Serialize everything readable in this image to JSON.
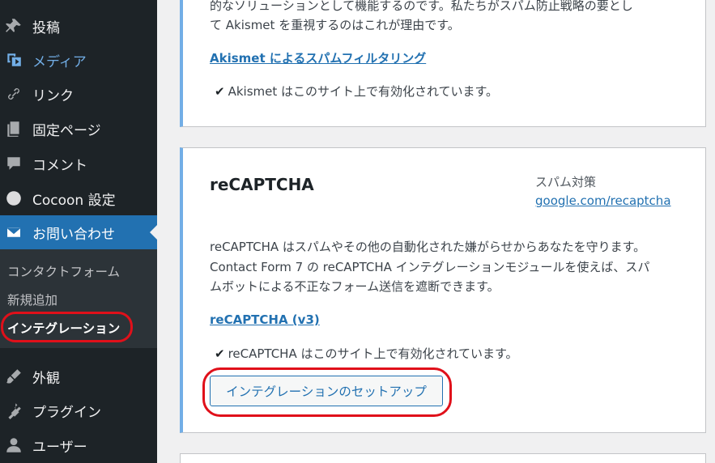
{
  "sidebar": {
    "items": [
      {
        "label": "投稿",
        "icon": "pin-icon"
      },
      {
        "label": "メディア",
        "icon": "media-icon"
      },
      {
        "label": "リンク",
        "icon": "link-icon"
      },
      {
        "label": "固定ページ",
        "icon": "pages-icon"
      },
      {
        "label": "コメント",
        "icon": "comment-icon"
      },
      {
        "label": "Cocoon 設定",
        "icon": "circle-icon"
      },
      {
        "label": "お問い合わせ",
        "icon": "mail-icon"
      },
      {
        "label": "外観",
        "icon": "brush-icon"
      },
      {
        "label": "プラグイン",
        "icon": "plugin-icon"
      },
      {
        "label": "ユーザー",
        "icon": "user-icon"
      }
    ],
    "submenu": [
      {
        "label": "コンタクトフォーム"
      },
      {
        "label": "新規追加"
      },
      {
        "label": "インテグレーション"
      }
    ]
  },
  "akismet": {
    "desc_line1": "的なソリューションとして機能するのです。私たちがスパム防止戦略の要とし",
    "desc_line2": "て Akismet を重視するのはこれが理由です。",
    "link": "Akismet によるスパムフィルタリング",
    "status": "Akismet はこのサイト上で有効化されています。"
  },
  "recaptcha": {
    "title": "reCAPTCHA",
    "category": "スパム対策",
    "site_link": "google.com/recaptcha",
    "desc_line1": "reCAPTCHA はスパムやその他の自動化された嫌がらせからあなたを守ります。",
    "desc_line2": "Contact Form 7 の reCAPTCHA インテグレーションモジュールを使えば、スパ",
    "desc_line3": "ムボットによる不正なフォーム送信を遮断できます。",
    "link": "reCAPTCHA (v3)",
    "status": "reCAPTCHA はこのサイト上で有効化されています。",
    "setup_button": "インテグレーションのセットアップ"
  },
  "check_mark": "✔"
}
